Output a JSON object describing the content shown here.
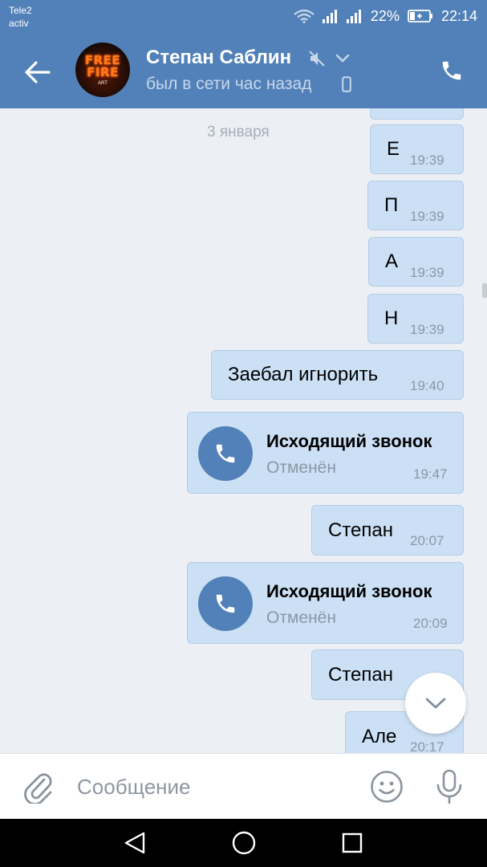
{
  "status_bar": {
    "carrier_line1": "Tele2",
    "carrier_line2": "activ",
    "battery_percent": "22%",
    "time": "22:14"
  },
  "header": {
    "contact_name": "Степан Саблин",
    "last_seen": "был в сети час назад",
    "avatar_text_line1": "FREE",
    "avatar_text_line2": "FIRE",
    "avatar_sub": "ART"
  },
  "chat": {
    "date_separator": "3 января",
    "messages": [
      {
        "text": "Е",
        "time": "19:39"
      },
      {
        "text": "П",
        "time": "19:39"
      },
      {
        "text": "А",
        "time": "19:39"
      },
      {
        "text": "Н",
        "time": "19:39"
      },
      {
        "text": "Заебал игнорить",
        "time": "19:40"
      },
      {
        "type": "call",
        "title": "Исходящий звонок",
        "status": "Отменён",
        "time": "19:47"
      },
      {
        "text": "Степан",
        "time": "20:07"
      },
      {
        "type": "call",
        "title": "Исходящий звонок",
        "status": "Отменён",
        "time": "20:09"
      },
      {
        "text": "Степан",
        "time": ""
      },
      {
        "text": "Але",
        "time": "20:17"
      }
    ]
  },
  "input": {
    "placeholder": "Сообщение"
  },
  "colors": {
    "header_blue": "#5181b8",
    "bubble_out": "#cce0f5",
    "chat_background": "#ecf0f4"
  }
}
